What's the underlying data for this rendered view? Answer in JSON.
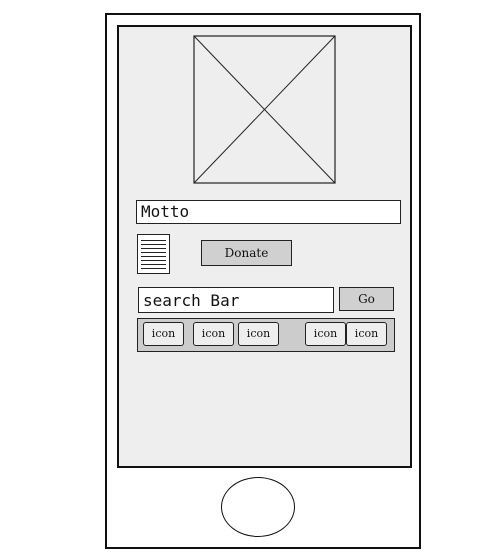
{
  "motto": {
    "text": "Motto"
  },
  "donate": {
    "label": "Donate"
  },
  "search": {
    "value": "search Bar",
    "go_label": "Go"
  },
  "icon_bar": {
    "items": [
      {
        "label": "icon"
      },
      {
        "label": "icon"
      },
      {
        "label": "icon"
      },
      {
        "label": "icon"
      },
      {
        "label": "icon"
      }
    ]
  },
  "colors": {
    "screen_background": "#eeeeee",
    "button_fill": "#d0d0d0",
    "icon_bar_fill": "#cccccc",
    "outline": "#222222"
  }
}
